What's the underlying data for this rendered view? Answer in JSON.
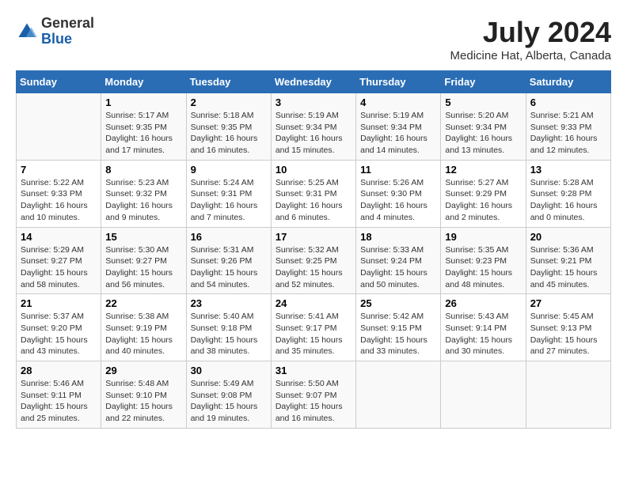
{
  "header": {
    "logo_general": "General",
    "logo_blue": "Blue",
    "month_title": "July 2024",
    "location": "Medicine Hat, Alberta, Canada"
  },
  "days_of_week": [
    "Sunday",
    "Monday",
    "Tuesday",
    "Wednesday",
    "Thursday",
    "Friday",
    "Saturday"
  ],
  "weeks": [
    [
      {
        "day": "",
        "sunrise": "",
        "sunset": "",
        "daylight": ""
      },
      {
        "day": "1",
        "sunrise": "Sunrise: 5:17 AM",
        "sunset": "Sunset: 9:35 PM",
        "daylight": "Daylight: 16 hours and 17 minutes."
      },
      {
        "day": "2",
        "sunrise": "Sunrise: 5:18 AM",
        "sunset": "Sunset: 9:35 PM",
        "daylight": "Daylight: 16 hours and 16 minutes."
      },
      {
        "day": "3",
        "sunrise": "Sunrise: 5:19 AM",
        "sunset": "Sunset: 9:34 PM",
        "daylight": "Daylight: 16 hours and 15 minutes."
      },
      {
        "day": "4",
        "sunrise": "Sunrise: 5:19 AM",
        "sunset": "Sunset: 9:34 PM",
        "daylight": "Daylight: 16 hours and 14 minutes."
      },
      {
        "day": "5",
        "sunrise": "Sunrise: 5:20 AM",
        "sunset": "Sunset: 9:34 PM",
        "daylight": "Daylight: 16 hours and 13 minutes."
      },
      {
        "day": "6",
        "sunrise": "Sunrise: 5:21 AM",
        "sunset": "Sunset: 9:33 PM",
        "daylight": "Daylight: 16 hours and 12 minutes."
      }
    ],
    [
      {
        "day": "7",
        "sunrise": "Sunrise: 5:22 AM",
        "sunset": "Sunset: 9:33 PM",
        "daylight": "Daylight: 16 hours and 10 minutes."
      },
      {
        "day": "8",
        "sunrise": "Sunrise: 5:23 AM",
        "sunset": "Sunset: 9:32 PM",
        "daylight": "Daylight: 16 hours and 9 minutes."
      },
      {
        "day": "9",
        "sunrise": "Sunrise: 5:24 AM",
        "sunset": "Sunset: 9:31 PM",
        "daylight": "Daylight: 16 hours and 7 minutes."
      },
      {
        "day": "10",
        "sunrise": "Sunrise: 5:25 AM",
        "sunset": "Sunset: 9:31 PM",
        "daylight": "Daylight: 16 hours and 6 minutes."
      },
      {
        "day": "11",
        "sunrise": "Sunrise: 5:26 AM",
        "sunset": "Sunset: 9:30 PM",
        "daylight": "Daylight: 16 hours and 4 minutes."
      },
      {
        "day": "12",
        "sunrise": "Sunrise: 5:27 AM",
        "sunset": "Sunset: 9:29 PM",
        "daylight": "Daylight: 16 hours and 2 minutes."
      },
      {
        "day": "13",
        "sunrise": "Sunrise: 5:28 AM",
        "sunset": "Sunset: 9:28 PM",
        "daylight": "Daylight: 16 hours and 0 minutes."
      }
    ],
    [
      {
        "day": "14",
        "sunrise": "Sunrise: 5:29 AM",
        "sunset": "Sunset: 9:27 PM",
        "daylight": "Daylight: 15 hours and 58 minutes."
      },
      {
        "day": "15",
        "sunrise": "Sunrise: 5:30 AM",
        "sunset": "Sunset: 9:27 PM",
        "daylight": "Daylight: 15 hours and 56 minutes."
      },
      {
        "day": "16",
        "sunrise": "Sunrise: 5:31 AM",
        "sunset": "Sunset: 9:26 PM",
        "daylight": "Daylight: 15 hours and 54 minutes."
      },
      {
        "day": "17",
        "sunrise": "Sunrise: 5:32 AM",
        "sunset": "Sunset: 9:25 PM",
        "daylight": "Daylight: 15 hours and 52 minutes."
      },
      {
        "day": "18",
        "sunrise": "Sunrise: 5:33 AM",
        "sunset": "Sunset: 9:24 PM",
        "daylight": "Daylight: 15 hours and 50 minutes."
      },
      {
        "day": "19",
        "sunrise": "Sunrise: 5:35 AM",
        "sunset": "Sunset: 9:23 PM",
        "daylight": "Daylight: 15 hours and 48 minutes."
      },
      {
        "day": "20",
        "sunrise": "Sunrise: 5:36 AM",
        "sunset": "Sunset: 9:21 PM",
        "daylight": "Daylight: 15 hours and 45 minutes."
      }
    ],
    [
      {
        "day": "21",
        "sunrise": "Sunrise: 5:37 AM",
        "sunset": "Sunset: 9:20 PM",
        "daylight": "Daylight: 15 hours and 43 minutes."
      },
      {
        "day": "22",
        "sunrise": "Sunrise: 5:38 AM",
        "sunset": "Sunset: 9:19 PM",
        "daylight": "Daylight: 15 hours and 40 minutes."
      },
      {
        "day": "23",
        "sunrise": "Sunrise: 5:40 AM",
        "sunset": "Sunset: 9:18 PM",
        "daylight": "Daylight: 15 hours and 38 minutes."
      },
      {
        "day": "24",
        "sunrise": "Sunrise: 5:41 AM",
        "sunset": "Sunset: 9:17 PM",
        "daylight": "Daylight: 15 hours and 35 minutes."
      },
      {
        "day": "25",
        "sunrise": "Sunrise: 5:42 AM",
        "sunset": "Sunset: 9:15 PM",
        "daylight": "Daylight: 15 hours and 33 minutes."
      },
      {
        "day": "26",
        "sunrise": "Sunrise: 5:43 AM",
        "sunset": "Sunset: 9:14 PM",
        "daylight": "Daylight: 15 hours and 30 minutes."
      },
      {
        "day": "27",
        "sunrise": "Sunrise: 5:45 AM",
        "sunset": "Sunset: 9:13 PM",
        "daylight": "Daylight: 15 hours and 27 minutes."
      }
    ],
    [
      {
        "day": "28",
        "sunrise": "Sunrise: 5:46 AM",
        "sunset": "Sunset: 9:11 PM",
        "daylight": "Daylight: 15 hours and 25 minutes."
      },
      {
        "day": "29",
        "sunrise": "Sunrise: 5:48 AM",
        "sunset": "Sunset: 9:10 PM",
        "daylight": "Daylight: 15 hours and 22 minutes."
      },
      {
        "day": "30",
        "sunrise": "Sunrise: 5:49 AM",
        "sunset": "Sunset: 9:08 PM",
        "daylight": "Daylight: 15 hours and 19 minutes."
      },
      {
        "day": "31",
        "sunrise": "Sunrise: 5:50 AM",
        "sunset": "Sunset: 9:07 PM",
        "daylight": "Daylight: 15 hours and 16 minutes."
      },
      {
        "day": "",
        "sunrise": "",
        "sunset": "",
        "daylight": ""
      },
      {
        "day": "",
        "sunrise": "",
        "sunset": "",
        "daylight": ""
      },
      {
        "day": "",
        "sunrise": "",
        "sunset": "",
        "daylight": ""
      }
    ]
  ]
}
